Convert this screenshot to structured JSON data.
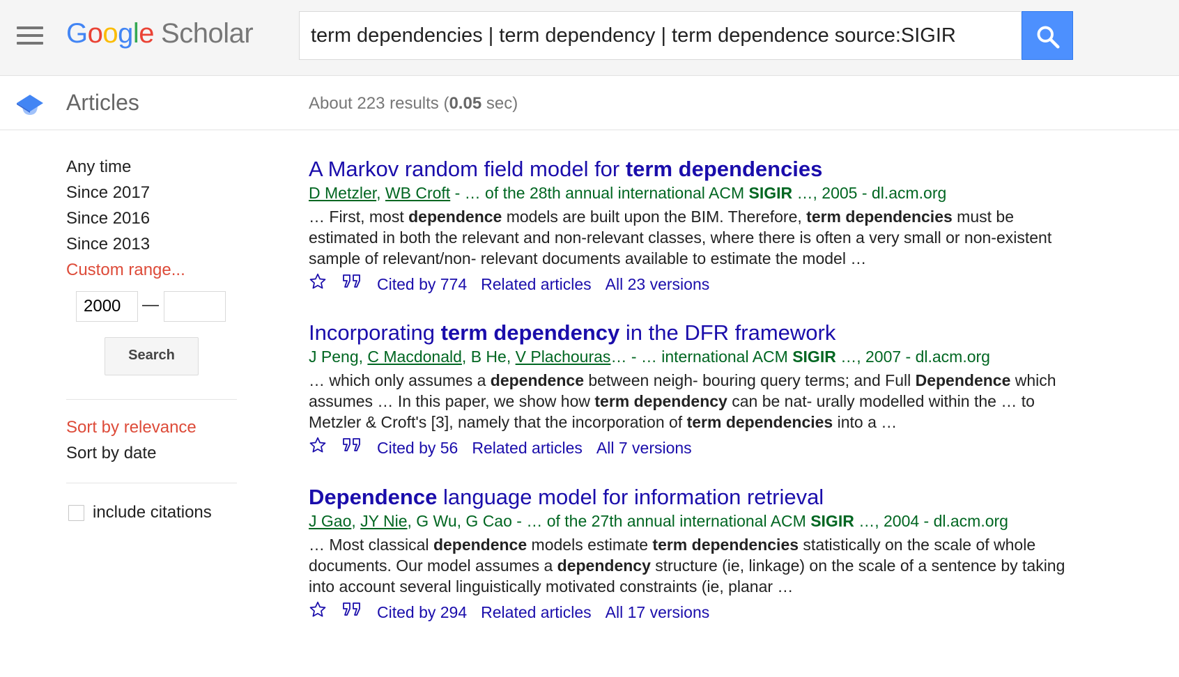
{
  "header": {
    "logo_letters": [
      "G",
      "o",
      "o",
      "g",
      "l",
      "e"
    ],
    "logo_product": "Scholar",
    "search_query": "term dependencies | term dependency | term dependence source:SIGIR",
    "colors": {
      "blue": "#4285f4",
      "red": "#ea4335",
      "yellow": "#fbbc05",
      "green": "#34a853",
      "search_button": "#4d90fe"
    }
  },
  "subheader": {
    "section": "Articles",
    "results_prefix": "About 223 results (",
    "results_time": "0.05",
    "results_suffix": " sec)"
  },
  "sidebar": {
    "time_filters": [
      "Any time",
      "Since 2017",
      "Since 2016",
      "Since 2013"
    ],
    "custom_range": "Custom range...",
    "range_from": "2000",
    "range_to": "",
    "range_dash": "—",
    "search_label": "Search",
    "sort_relevance": "Sort by relevance",
    "sort_date": "Sort by date",
    "include_citations": "include citations"
  },
  "results": [
    {
      "title": [
        {
          "t": "A Markov random field model for ",
          "b": false
        },
        {
          "t": "term dependencies",
          "b": true
        }
      ],
      "meta": [
        {
          "t": "D Metzler",
          "link": true
        },
        {
          "t": ", "
        },
        {
          "t": "WB Croft",
          "link": true
        },
        {
          "t": " - … of the 28th annual international ACM "
        },
        {
          "t": "SIGIR",
          "b": true
        },
        {
          "t": " …, 2005 - dl.acm.org"
        }
      ],
      "snippet": [
        {
          "t": "… First, most "
        },
        {
          "t": "dependence",
          "b": true
        },
        {
          "t": " models are built upon the BIM. Therefore, "
        },
        {
          "t": "term dependencies",
          "b": true
        },
        {
          "t": " must be estimated in both the relevant and non-relevant classes, where there is often a very small or non-existent sample of relevant/non- relevant documents available to estimate the model …"
        }
      ],
      "cited_by": "Cited by 774",
      "related": "Related articles",
      "versions": "All 23 versions"
    },
    {
      "title": [
        {
          "t": "Incorporating ",
          "b": false
        },
        {
          "t": "term dependency",
          "b": true
        },
        {
          "t": " in the DFR framework",
          "b": false
        }
      ],
      "meta": [
        {
          "t": "J Peng, "
        },
        {
          "t": "C Macdonald",
          "link": true
        },
        {
          "t": ", B He, "
        },
        {
          "t": "V Plachouras",
          "link": true
        },
        {
          "t": "… - … international ACM "
        },
        {
          "t": "SIGIR",
          "b": true
        },
        {
          "t": " …, 2007 - dl.acm.org"
        }
      ],
      "snippet": [
        {
          "t": "… which only assumes a "
        },
        {
          "t": "dependence",
          "b": true
        },
        {
          "t": " between neigh- bouring query terms; and Full "
        },
        {
          "t": "Dependence",
          "b": true
        },
        {
          "t": " which assumes … In this paper, we show how "
        },
        {
          "t": "term dependency",
          "b": true
        },
        {
          "t": " can be nat- urally modelled within the … to Metzler & Croft's [3], namely that the incorporation of "
        },
        {
          "t": "term dependencies",
          "b": true
        },
        {
          "t": " into a …"
        }
      ],
      "cited_by": "Cited by 56",
      "related": "Related articles",
      "versions": "All 7 versions"
    },
    {
      "title": [
        {
          "t": "Dependence",
          "b": true
        },
        {
          "t": " language model for information retrieval",
          "b": false
        }
      ],
      "meta": [
        {
          "t": "J Gao",
          "link": true
        },
        {
          "t": ", "
        },
        {
          "t": "JY Nie",
          "link": true
        },
        {
          "t": ", G Wu, G Cao - … of the 27th annual international ACM "
        },
        {
          "t": "SIGIR",
          "b": true
        },
        {
          "t": " …, 2004 - dl.acm.org"
        }
      ],
      "snippet": [
        {
          "t": "… Most classical "
        },
        {
          "t": "dependence",
          "b": true
        },
        {
          "t": " models estimate "
        },
        {
          "t": "term dependencies",
          "b": true
        },
        {
          "t": " statistically on the scale of whole documents. Our model assumes a "
        },
        {
          "t": "dependency",
          "b": true
        },
        {
          "t": " structure (ie, linkage) on the scale of a sentence by taking into account several linguistically motivated constraints (ie, planar …"
        }
      ],
      "cited_by": "Cited by 294",
      "related": "Related articles",
      "versions": "All 17 versions"
    }
  ]
}
